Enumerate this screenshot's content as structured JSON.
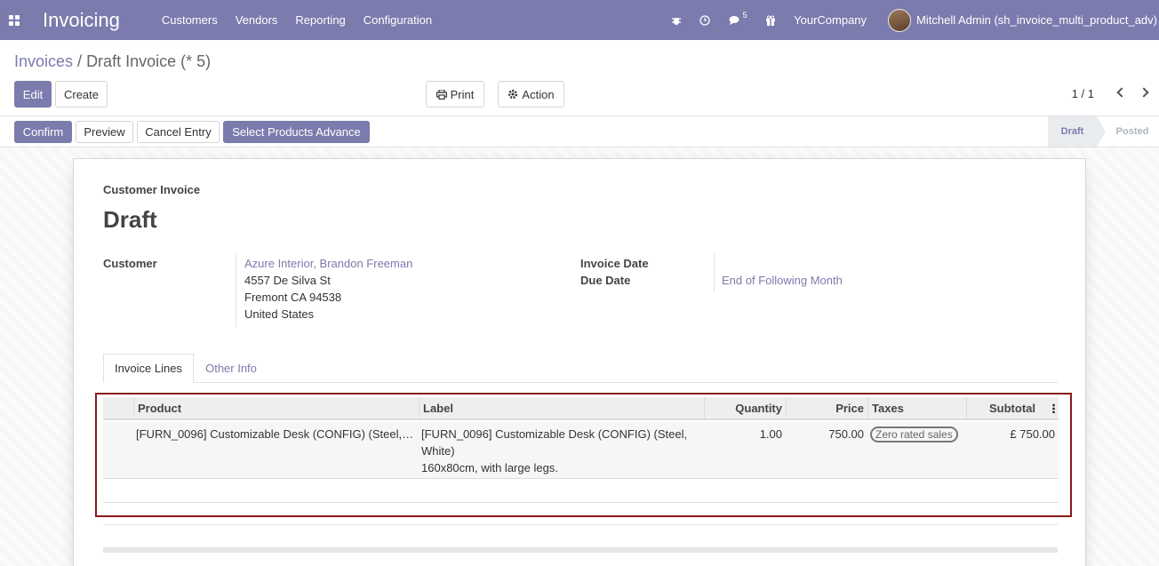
{
  "topbar": {
    "app_title": "Invoicing",
    "menu": [
      "Customers",
      "Vendors",
      "Reporting",
      "Configuration"
    ],
    "message_count": "5",
    "company": "YourCompany",
    "user": "Mitchell Admin (sh_invoice_multi_product_adv)",
    "icons": [
      "apps-icon",
      "bug-icon",
      "clock-icon",
      "chat-icon",
      "gift-icon"
    ]
  },
  "breadcrumb": {
    "parent": "Invoices",
    "separator": "/",
    "current": "Draft Invoice (* 5)"
  },
  "buttons": {
    "edit": "Edit",
    "create": "Create",
    "print": "Print",
    "action": "Action"
  },
  "pager": {
    "value": "1 / 1"
  },
  "statusbar": {
    "confirm": "Confirm",
    "preview": "Preview",
    "cancel_entry": "Cancel Entry",
    "select_products": "Select Products Advance",
    "stages": [
      "Draft",
      "Posted"
    ],
    "active_stage": "Draft"
  },
  "invoice": {
    "type": "Customer Invoice",
    "state_title": "Draft",
    "customer_label": "Customer",
    "customer_name": "Azure Interior, Brandon Freeman",
    "address": [
      "4557 De Silva St",
      "Fremont CA 94538",
      "United States"
    ],
    "invoice_date_label": "Invoice Date",
    "due_date_label": "Due Date",
    "due_date_value": "End of Following Month"
  },
  "tabs": [
    "Invoice Lines",
    "Other Info"
  ],
  "lines": {
    "headers": [
      "Product",
      "Label",
      "Quantity",
      "Price",
      "Taxes",
      "Subtotal"
    ],
    "rows": [
      {
        "product": "[FURN_0096] Customizable Desk (CONFIG) (Steel,…",
        "label": [
          "[FURN_0096] Customizable Desk (CONFIG) (Steel,",
          "White)",
          "160x80cm, with large legs."
        ],
        "quantity": "1.00",
        "price": "750.00",
        "taxes": "Zero rated sales",
        "subtotal": "£ 750.00"
      }
    ]
  },
  "colors": {
    "brand": "#7c7bad",
    "highlight_frame": "#8b1a1a"
  }
}
